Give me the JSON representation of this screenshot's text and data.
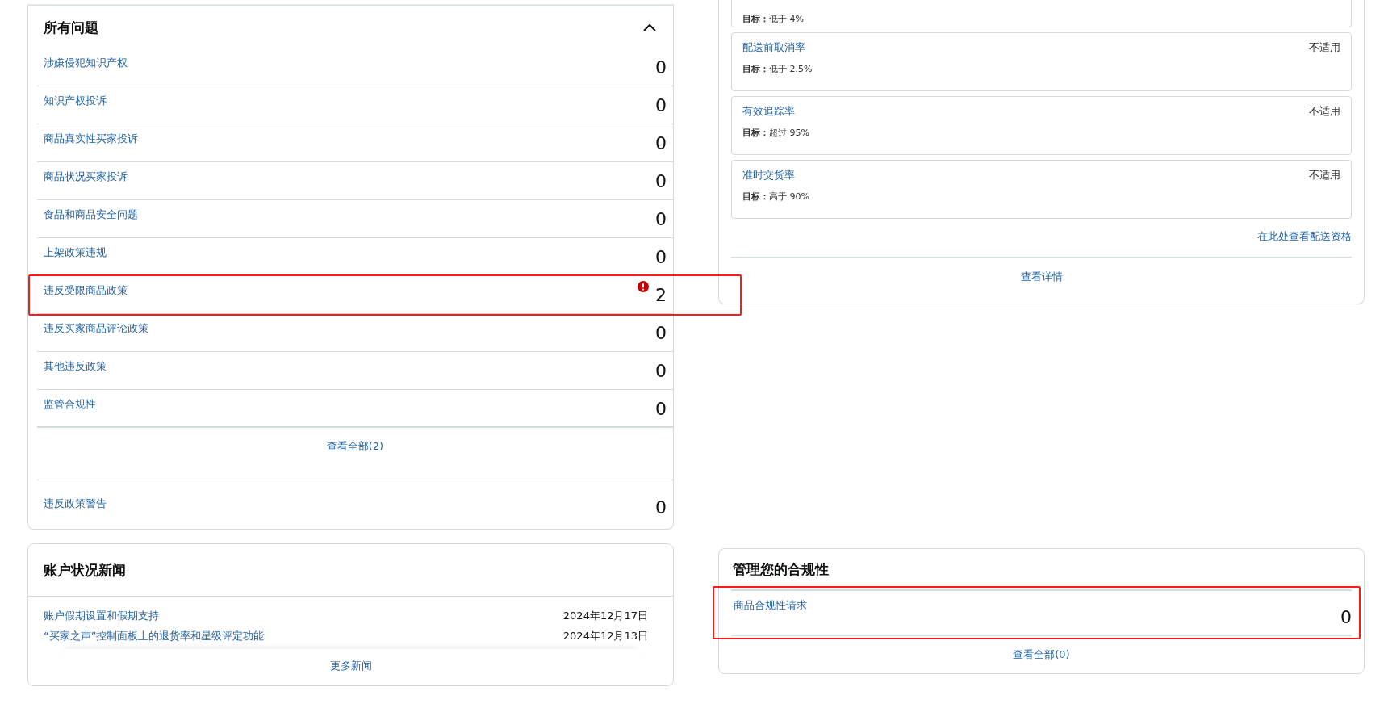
{
  "issues": {
    "title": "所有问题",
    "expanded": true,
    "rows": [
      {
        "label": "涉嫌侵犯知识产权",
        "count": "0",
        "alert": false,
        "highlighted": false
      },
      {
        "label": "知识产权投诉",
        "count": "0",
        "alert": false,
        "highlighted": false
      },
      {
        "label": "商品真实性买家投诉",
        "count": "0",
        "alert": false,
        "highlighted": false
      },
      {
        "label": "商品状况买家投诉",
        "count": "0",
        "alert": false,
        "highlighted": false
      },
      {
        "label": "食品和商品安全问题",
        "count": "0",
        "alert": false,
        "highlighted": false
      },
      {
        "label": "上架政策违规",
        "count": "0",
        "alert": false,
        "highlighted": false
      },
      {
        "label": "违反受限商品政策",
        "count": "2",
        "alert": true,
        "highlighted": true
      },
      {
        "label": "违反买家商品评论政策",
        "count": "0",
        "alert": false,
        "highlighted": false
      },
      {
        "label": "其他违反政策",
        "count": "0",
        "alert": false,
        "highlighted": false
      },
      {
        "label": "监管合规性",
        "count": "0",
        "alert": false,
        "highlighted": false
      }
    ],
    "view_all": "查看全部(2)",
    "warning": {
      "label": "违反政策警告",
      "count": "0"
    }
  },
  "news": {
    "title": "账户状况新闻",
    "items": [
      {
        "title": "账户假期设置和假期支持",
        "date": "2024年12月17日"
      },
      {
        "title": "“买家之声”控制面板上的退货率和星级评定功能",
        "date": "2024年12月13日"
      }
    ],
    "more": "更多新闻"
  },
  "shipping": {
    "partial_target": "**目标：**低于 4%",
    "metrics": [
      {
        "name": "配送前取消率",
        "target": "**目标：**低于 2.5%",
        "status": "不适用"
      },
      {
        "name": "有效追踪率",
        "target": "**目标：**超过 95%",
        "status": "不适用"
      },
      {
        "name": "准时交货率",
        "target": "**目标：**高于 90%",
        "status": "不适用"
      }
    ],
    "link": "在此处查看配送资格",
    "details": "查看详情"
  },
  "compliance": {
    "title": "管理您的合规性",
    "items": [
      {
        "label": "商品合规性请求",
        "count": "0",
        "highlighted": true
      }
    ],
    "view_all": "查看全部(0)"
  }
}
